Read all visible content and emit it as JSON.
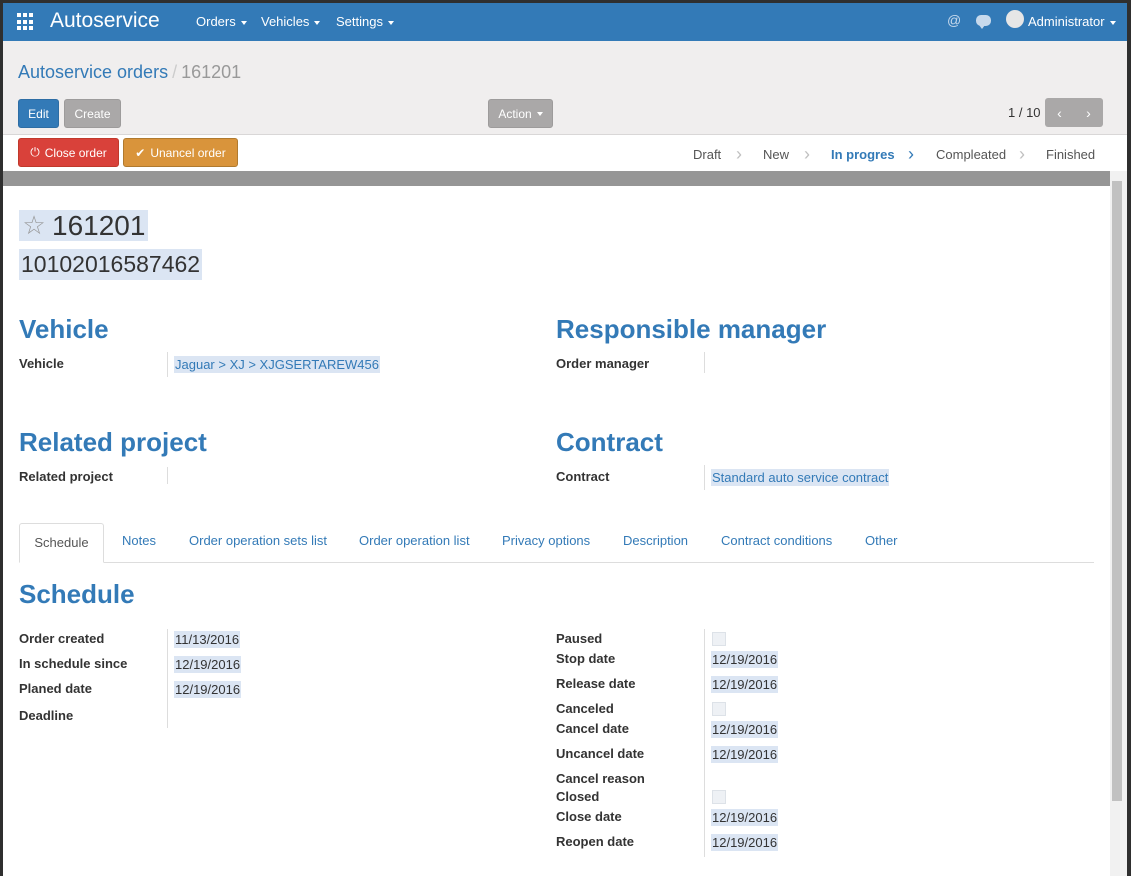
{
  "navbar": {
    "brand": "Autoservice",
    "menus": [
      "Orders",
      "Vehicles",
      "Settings"
    ],
    "at_icon": "@",
    "user": "Administrator"
  },
  "breadcrumb": {
    "parent": "Autoservice orders",
    "separator": "/",
    "current": "161201"
  },
  "buttons": {
    "edit": "Edit",
    "create": "Create",
    "action": "Action",
    "close_order": "Close order",
    "uncancel_order": "Unancel order"
  },
  "pager": {
    "value": "1 / 10"
  },
  "stages": [
    {
      "label": "Draft",
      "active": false
    },
    {
      "label": "New",
      "active": false
    },
    {
      "label": "In progres",
      "active": true
    },
    {
      "label": "Compleated",
      "active": false
    },
    {
      "label": "Finished",
      "active": false
    }
  ],
  "record": {
    "title": "161201",
    "subtitle": "10102016587462"
  },
  "sections": {
    "vehicle": {
      "heading": "Vehicle",
      "label": "Vehicle",
      "value": "Jaguar > XJ > XJGSERTAREW456"
    },
    "manager": {
      "heading": "Responsible manager",
      "label": "Order manager",
      "value": ""
    },
    "project": {
      "heading": "Related project",
      "label": "Related project",
      "value": ""
    },
    "contract": {
      "heading": "Contract",
      "label": "Contract",
      "value": "Standard auto service contract"
    }
  },
  "tabs": [
    "Schedule",
    "Notes",
    "Order operation sets list",
    "Order operation list",
    "Privacy options",
    "Description",
    "Contract conditions",
    "Other"
  ],
  "schedule": {
    "heading": "Schedule",
    "left": [
      {
        "label": "Order created",
        "value": "11/13/2016"
      },
      {
        "label": "In schedule since",
        "value": "12/19/2016"
      },
      {
        "label": "Planed date",
        "value": "12/19/2016"
      },
      {
        "label": "Deadline",
        "value": ""
      }
    ],
    "right": [
      {
        "label": "Paused",
        "checkbox": true
      },
      {
        "label": "Stop date",
        "value": "12/19/2016"
      },
      {
        "label": "Release date",
        "value": "12/19/2016"
      },
      {
        "label": "Canceled",
        "checkbox": true
      },
      {
        "label": "Cancel date",
        "value": "12/19/2016"
      },
      {
        "label": "Uncancel date",
        "value": "12/19/2016"
      },
      {
        "label": "Cancel reason",
        "value": ""
      },
      {
        "label": "Closed",
        "checkbox": true
      },
      {
        "label": "Close date",
        "value": "12/19/2016"
      },
      {
        "label": "Reopen date",
        "value": "12/19/2016"
      }
    ]
  },
  "icons": {
    "apps": "apps-grid-icon",
    "star": "☆",
    "power": "⏻",
    "check": "✔",
    "chevron_left": "‹",
    "chevron_right": "›",
    "stage_chevron": "›"
  },
  "colors": {
    "primary": "#337ab7",
    "danger": "#d9413a",
    "warning": "#d9943b",
    "muted_button": "#aaa8a8"
  }
}
